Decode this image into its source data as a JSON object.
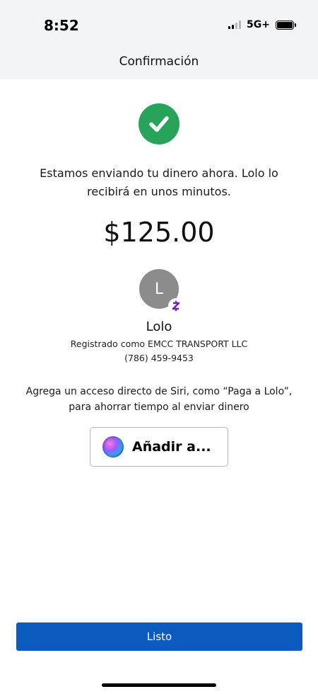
{
  "status_bar": {
    "time": "8:52",
    "network": "5G+",
    "signal_bars_active": 2,
    "signal_bars_total": 4,
    "battery_level": 1.0
  },
  "nav": {
    "title": "Confirmación"
  },
  "confirmation": {
    "icon": "checkmark-icon",
    "icon_color": "#27a35a",
    "message": "Estamos enviando tu dinero ahora. Lolo lo recibirá en unos minutos.",
    "amount": "$125.00"
  },
  "recipient": {
    "initial": "L",
    "name": "Lolo",
    "registered_as": "Registrado como EMCC TRANSPORT LLC",
    "phone": "(786) 459-9453",
    "badge_icon": "zelle-icon",
    "badge_color": "#6d1ed4"
  },
  "siri": {
    "prompt": "Agrega un acceso directo de Siri, como “Paga a Lolo”, para ahorrar tiempo al enviar dinero",
    "button_label": "Añadir a...",
    "icon": "siri-icon"
  },
  "footer": {
    "done_label": "Listo",
    "done_color": "#0a5bbd"
  }
}
